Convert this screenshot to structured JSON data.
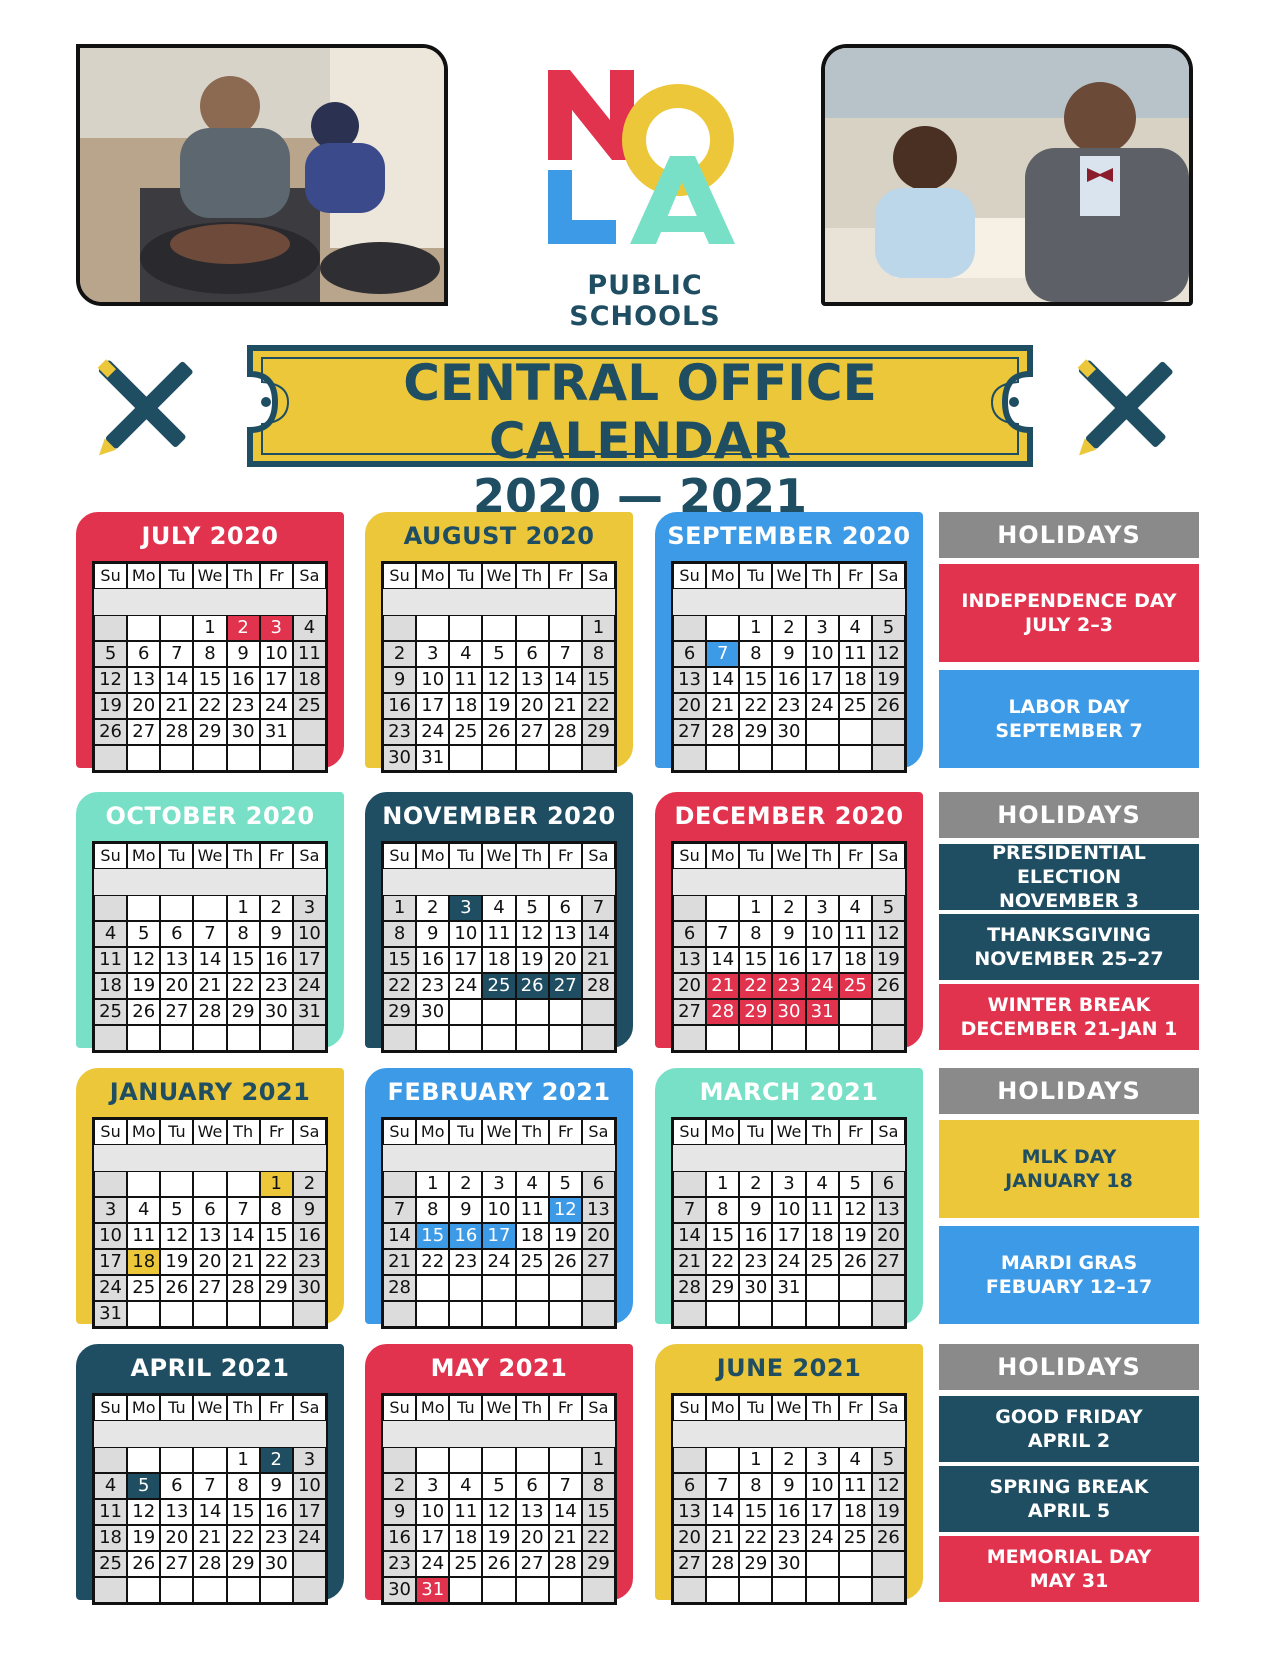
{
  "logo": {
    "letters": [
      "N",
      "O",
      "L",
      "A"
    ],
    "subtitle": "PUBLIC SCHOOLS"
  },
  "banner": {
    "title": "CENTRAL OFFICE CALENDAR",
    "years": "2020 — 2021"
  },
  "colors": {
    "red": "#e2334e",
    "yellow": "#ecc73a",
    "blue": "#3d9ae6",
    "teal": "#79e0c8",
    "navy": "#1f4e63",
    "gray": "#8a8a8a"
  },
  "weekdays": [
    "Su",
    "Mo",
    "Tu",
    "We",
    "Th",
    "Fr",
    "Sa"
  ],
  "months": [
    {
      "name": "JULY 2020",
      "color": "red",
      "titleColor": "#ffffff",
      "start": 3,
      "days": 31,
      "highlights": {
        "red": [
          2,
          3
        ]
      }
    },
    {
      "name": "AUGUST 2020",
      "color": "yellow",
      "titleColor": "#1f4e63",
      "start": 6,
      "days": 31,
      "highlights": {}
    },
    {
      "name": "SEPTEMBER 2020",
      "color": "blue",
      "titleColor": "#ffffff",
      "start": 2,
      "days": 30,
      "highlights": {
        "blue": [
          7
        ]
      }
    },
    {
      "name": "OCTOBER 2020",
      "color": "teal",
      "titleColor": "#ffffff",
      "start": 4,
      "days": 31,
      "highlights": {}
    },
    {
      "name": "NOVEMBER 2020",
      "color": "navy",
      "titleColor": "#ffffff",
      "start": 0,
      "days": 30,
      "highlights": {
        "navy": [
          3,
          25,
          26,
          27
        ]
      }
    },
    {
      "name": "DECEMBER 2020",
      "color": "red",
      "titleColor": "#ffffff",
      "start": 2,
      "days": 31,
      "highlights": {
        "red": [
          21,
          22,
          23,
          24,
          25,
          28,
          29,
          30,
          31
        ]
      }
    },
    {
      "name": "JANUARY 2021",
      "color": "yellow",
      "titleColor": "#1f4e63",
      "start": 5,
      "days": 31,
      "highlights": {
        "yellow": [
          1,
          18
        ]
      }
    },
    {
      "name": "FEBRUARY 2021",
      "color": "blue",
      "titleColor": "#ffffff",
      "start": 1,
      "days": 28,
      "highlights": {
        "blue": [
          12,
          15,
          16,
          17
        ]
      }
    },
    {
      "name": "MARCH 2021",
      "color": "teal",
      "titleColor": "#ffffff",
      "start": 1,
      "days": 31,
      "highlights": {}
    },
    {
      "name": "APRIL 2021",
      "color": "navy",
      "titleColor": "#ffffff",
      "start": 4,
      "days": 30,
      "highlights": {
        "navy": [
          2,
          5
        ]
      }
    },
    {
      "name": "MAY 2021",
      "color": "red",
      "titleColor": "#ffffff",
      "start": 6,
      "days": 31,
      "highlights": {
        "red": [
          31
        ]
      }
    },
    {
      "name": "JUNE 2021",
      "color": "yellow",
      "titleColor": "#1f4e63",
      "start": 2,
      "days": 30,
      "highlights": {}
    }
  ],
  "holidays": [
    {
      "heading": "HOLIDAYS",
      "items": [
        {
          "line1": "INDEPENDENCE DAY",
          "line2": "JULY 2–3",
          "color": "red"
        },
        {
          "line1": "LABOR DAY",
          "line2": "SEPTEMBER  7",
          "color": "blue"
        }
      ]
    },
    {
      "heading": "HOLIDAYS",
      "items": [
        {
          "line1": "PRESIDENTIAL ELECTION",
          "line2": "NOVEMBER 3",
          "color": "navy"
        },
        {
          "line1": "THANKSGIVING",
          "line2": "NOVEMBER 25–27",
          "color": "navy"
        },
        {
          "line1": "WINTER BREAK",
          "line2": "DECEMBER 21–JAN 1",
          "color": "red"
        }
      ]
    },
    {
      "heading": "HOLIDAYS",
      "items": [
        {
          "line1": "MLK DAY",
          "line2": "JANUARY 18",
          "color": "yellow"
        },
        {
          "line1": "MARDI GRAS",
          "line2": "FEBUARY 12–17",
          "color": "blue"
        }
      ]
    },
    {
      "heading": "HOLIDAYS",
      "items": [
        {
          "line1": "GOOD FRIDAY",
          "line2": "APRIL 2",
          "color": "navy"
        },
        {
          "line1": "SPRING BREAK",
          "line2": "APRIL 5",
          "color": "navy"
        },
        {
          "line1": "MEMORIAL DAY",
          "line2": "MAY 31",
          "color": "red"
        }
      ]
    }
  ]
}
